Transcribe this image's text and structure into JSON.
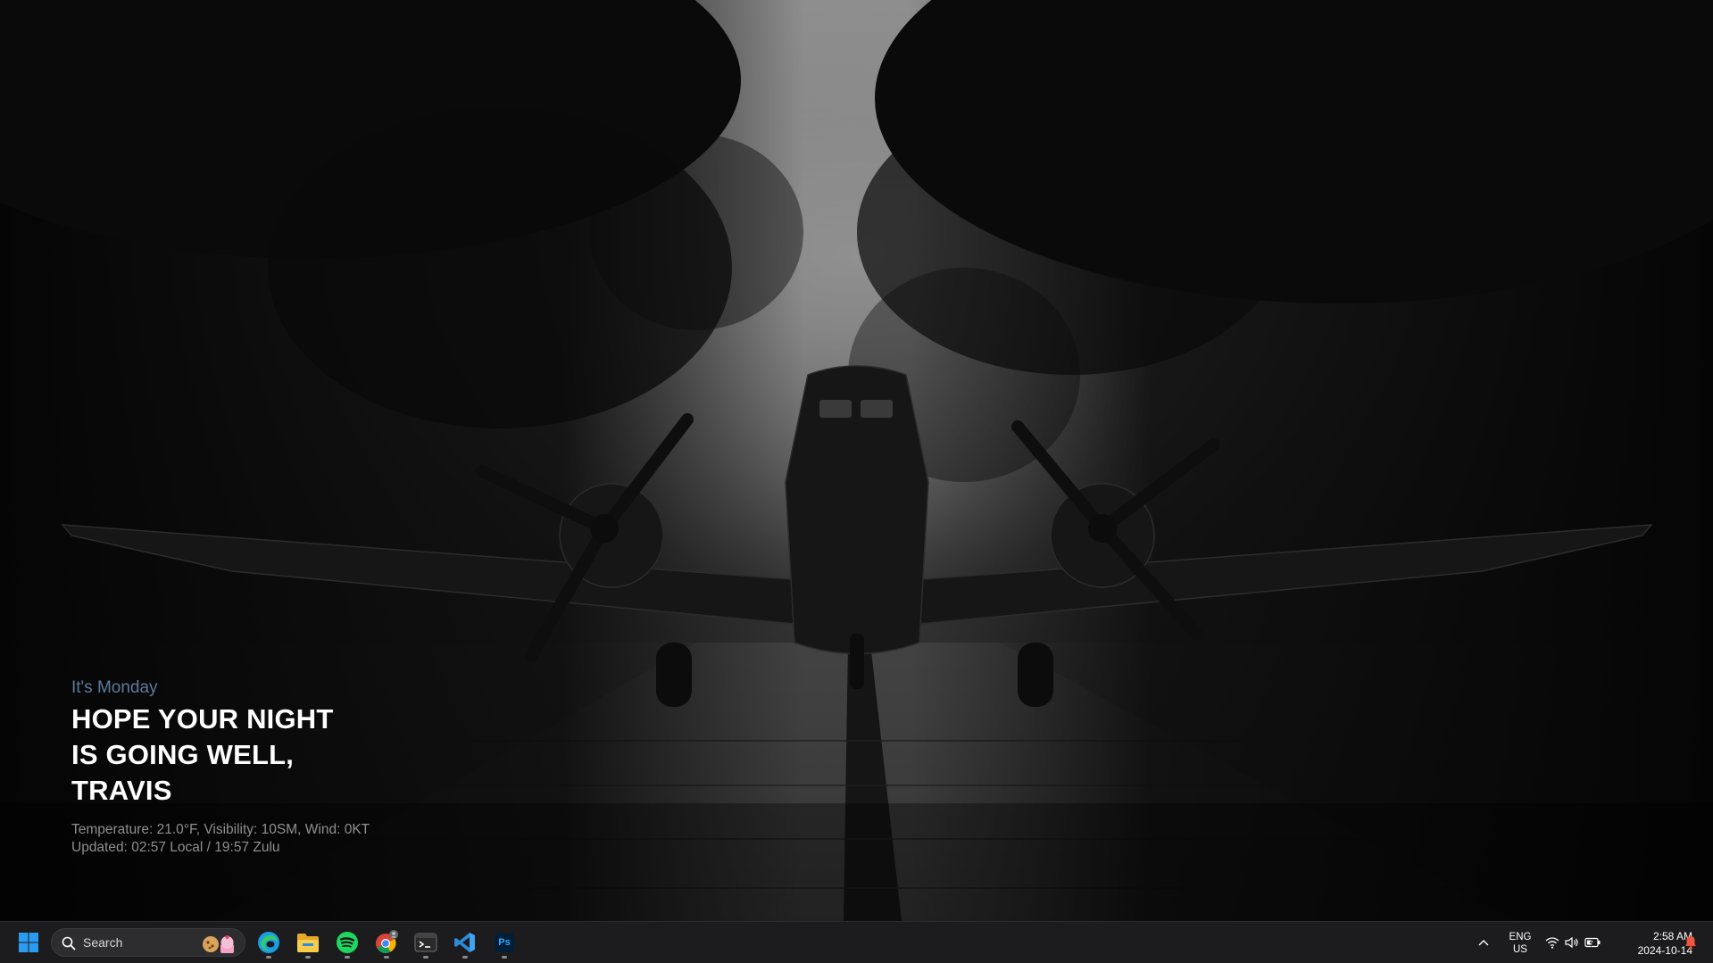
{
  "greeting": {
    "day": "It's Monday",
    "headline": [
      "HOPE YOUR NIGHT",
      "IS GOING WELL,",
      "TRAVIS"
    ],
    "weather": "Temperature: 21.0°F, Visibility: 10SM, Wind: 0KT",
    "updated": "Updated: 02:57 Local / 19:57 Zulu"
  },
  "taskbar": {
    "search_label": "Search",
    "apps": [
      {
        "name": "start",
        "icon": "windows-logo-icon"
      },
      {
        "name": "edge",
        "icon": "edge-icon",
        "running": true
      },
      {
        "name": "file-explorer",
        "icon": "folder-icon",
        "running": true
      },
      {
        "name": "spotify",
        "icon": "spotify-icon",
        "running": true
      },
      {
        "name": "chrome",
        "icon": "chrome-icon",
        "running": true
      },
      {
        "name": "terminal",
        "icon": "terminal-icon",
        "running": true
      },
      {
        "name": "vscode",
        "icon": "vscode-icon",
        "running": true
      },
      {
        "name": "photoshop",
        "icon": "photoshop-icon",
        "running": true
      }
    ],
    "photoshop_label": "Ps",
    "tray": {
      "language_line1": "ENG",
      "language_line2": "US",
      "time": "2:58 AM",
      "date": "2024-10-14"
    }
  },
  "colors": {
    "taskbar_bg": "#1c1c1e",
    "day_label": "#5d7b9e",
    "start_blue": "#2b9bf0",
    "spotify_green": "#1ed760",
    "vscode_blue": "#2a8bd8",
    "photoshop_bg": "#001e36",
    "photoshop_text": "#31a8ff"
  }
}
